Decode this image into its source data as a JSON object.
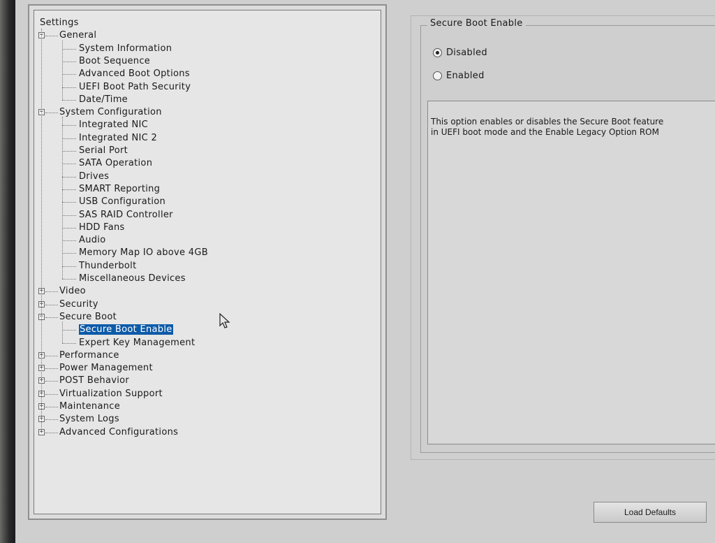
{
  "tree": {
    "root_label": "Settings",
    "categories": [
      {
        "label": "General",
        "expanded": true,
        "children": [
          "System Information",
          "Boot Sequence",
          "Advanced Boot Options",
          "UEFI Boot Path Security",
          "Date/Time"
        ]
      },
      {
        "label": "System Configuration",
        "expanded": true,
        "children": [
          "Integrated NIC",
          "Integrated NIC 2",
          "Serial Port",
          "SATA Operation",
          "Drives",
          "SMART Reporting",
          "USB Configuration",
          "SAS RAID Controller",
          "HDD Fans",
          "Audio",
          "Memory Map IO above 4GB",
          "Thunderbolt",
          "Miscellaneous Devices"
        ]
      },
      {
        "label": "Video",
        "expanded": false,
        "children": []
      },
      {
        "label": "Security",
        "expanded": false,
        "children": []
      },
      {
        "label": "Secure Boot",
        "expanded": true,
        "children": [
          "Secure Boot Enable",
          "Expert Key Management"
        ]
      },
      {
        "label": "Performance",
        "expanded": false,
        "children": []
      },
      {
        "label": "Power Management",
        "expanded": false,
        "children": []
      },
      {
        "label": "POST Behavior",
        "expanded": false,
        "children": []
      },
      {
        "label": "Virtualization Support",
        "expanded": false,
        "children": []
      },
      {
        "label": "Maintenance",
        "expanded": false,
        "children": []
      },
      {
        "label": "System Logs",
        "expanded": false,
        "children": []
      },
      {
        "label": "Advanced Configurations",
        "expanded": false,
        "children": []
      }
    ],
    "selected": "Secure Boot Enable"
  },
  "detail": {
    "group_title": "Secure Boot Enable",
    "options": [
      {
        "label": "Disabled",
        "checked": true
      },
      {
        "label": "Enabled",
        "checked": false
      }
    ],
    "description_lines": [
      "This option enables or disables the Secure Boot feature",
      "in UEFI boot mode and the Enable Legacy Option ROM"
    ]
  },
  "buttons": {
    "load_defaults": "Load Defaults"
  },
  "icons": {
    "expand": "plus-box-icon",
    "collapse": "minus-box-icon",
    "cursor": "mouse-pointer-icon"
  },
  "colors": {
    "selection": "#0d5aa8"
  }
}
